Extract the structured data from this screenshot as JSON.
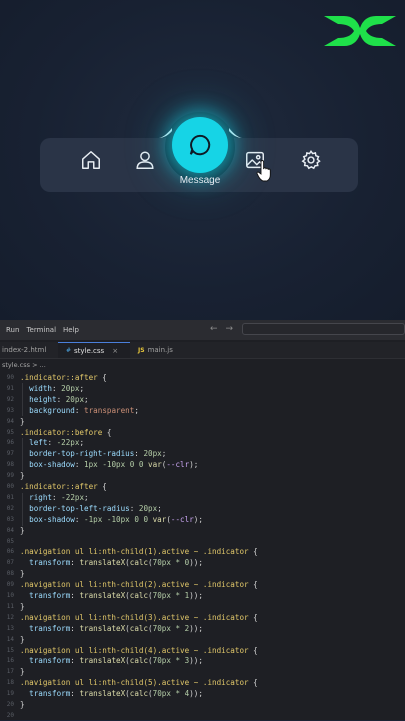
{
  "preview": {
    "nav_items": [
      {
        "icon": "home-icon"
      },
      {
        "icon": "user-icon"
      },
      {
        "icon": "message-icon",
        "label": "Message",
        "active": true
      },
      {
        "icon": "image-icon"
      },
      {
        "icon": "gear-icon"
      }
    ],
    "active_label": "Message",
    "accent": "#16d4e6"
  },
  "menu": [
    "Run",
    "Terminal",
    "Help"
  ],
  "tabs": [
    {
      "label": "index-2.html",
      "icon": "html-icon",
      "active": false
    },
    {
      "label": "style.css",
      "icon": "#",
      "active": true,
      "close": "×"
    },
    {
      "label": "main.js",
      "icon": "JS",
      "active": false
    }
  ],
  "breadcrumb": "style.css > ...",
  "code": [
    {
      "n": "90",
      "t": [
        [
          "sel",
          ".indicator::after "
        ],
        [
          "pun",
          "{"
        ]
      ]
    },
    {
      "n": "91",
      "t": [
        [
          "prop",
          "  width"
        ],
        [
          "pun",
          ": "
        ],
        [
          "num",
          "20px"
        ],
        [
          "pun",
          ";"
        ]
      ]
    },
    {
      "n": "92",
      "t": [
        [
          "prop",
          "  height"
        ],
        [
          "pun",
          ": "
        ],
        [
          "num",
          "20px"
        ],
        [
          "pun",
          ";"
        ]
      ]
    },
    {
      "n": "93",
      "t": [
        [
          "prop",
          "  background"
        ],
        [
          "pun",
          ": "
        ],
        [
          "val",
          "transparent"
        ],
        [
          "pun",
          ";"
        ]
      ]
    },
    {
      "n": "94",
      "t": [
        [
          "pun",
          "}"
        ]
      ]
    },
    {
      "n": "95",
      "t": [
        [
          "sel",
          ".indicator::before "
        ],
        [
          "pun",
          "{"
        ]
      ]
    },
    {
      "n": "96",
      "t": [
        [
          "prop",
          "  left"
        ],
        [
          "pun",
          ": "
        ],
        [
          "num",
          "-22px"
        ],
        [
          "pun",
          ";"
        ]
      ]
    },
    {
      "n": "97",
      "t": [
        [
          "prop",
          "  border-top-right-radius"
        ],
        [
          "pun",
          ": "
        ],
        [
          "num",
          "20px"
        ],
        [
          "pun",
          ";"
        ]
      ]
    },
    {
      "n": "98",
      "t": [
        [
          "prop",
          "  box-shadow"
        ],
        [
          "pun",
          ": "
        ],
        [
          "num",
          "1px -10px 0 0 "
        ],
        [
          "fn",
          "var"
        ],
        [
          "pun",
          "("
        ],
        [
          "var",
          "--clr"
        ],
        [
          "pun",
          ");"
        ]
      ]
    },
    {
      "n": "99",
      "t": [
        [
          "pun",
          "}"
        ]
      ]
    },
    {
      "n": "00",
      "t": [
        [
          "sel",
          ".indicator::after "
        ],
        [
          "pun",
          "{"
        ]
      ]
    },
    {
      "n": "01",
      "t": [
        [
          "prop",
          "  right"
        ],
        [
          "pun",
          ": "
        ],
        [
          "num",
          "-22px"
        ],
        [
          "pun",
          ";"
        ]
      ]
    },
    {
      "n": "02",
      "t": [
        [
          "prop",
          "  border-top-left-radius"
        ],
        [
          "pun",
          ": "
        ],
        [
          "num",
          "20px"
        ],
        [
          "pun",
          ";"
        ]
      ]
    },
    {
      "n": "03",
      "t": [
        [
          "prop",
          "  box-shadow"
        ],
        [
          "pun",
          ": "
        ],
        [
          "num",
          "-1px -10px 0 0 "
        ],
        [
          "fn",
          "var"
        ],
        [
          "pun",
          "("
        ],
        [
          "var",
          "--clr"
        ],
        [
          "pun",
          ");"
        ]
      ]
    },
    {
      "n": "04",
      "t": [
        [
          "pun",
          "}"
        ]
      ]
    },
    {
      "n": "05",
      "t": []
    },
    {
      "n": "06",
      "t": [
        [
          "sel",
          ".navigation ul li:nth-child(1).active ~ .indicator "
        ],
        [
          "pun",
          "{"
        ]
      ]
    },
    {
      "n": "07",
      "t": [
        [
          "prop",
          "  transform"
        ],
        [
          "pun",
          ": "
        ],
        [
          "fn",
          "translateX"
        ],
        [
          "pun",
          "("
        ],
        [
          "fn",
          "calc"
        ],
        [
          "pun",
          "("
        ],
        [
          "num",
          "70px * 0"
        ],
        [
          "pun",
          "));"
        ]
      ]
    },
    {
      "n": "08",
      "t": [
        [
          "pun",
          "}"
        ]
      ]
    },
    {
      "n": "09",
      "t": [
        [
          "sel",
          ".navigation ul li:nth-child(2).active ~ .indicator "
        ],
        [
          "pun",
          "{"
        ]
      ]
    },
    {
      "n": "10",
      "t": [
        [
          "prop",
          "  transform"
        ],
        [
          "pun",
          ": "
        ],
        [
          "fn",
          "translateX"
        ],
        [
          "pun",
          "("
        ],
        [
          "fn",
          "calc"
        ],
        [
          "pun",
          "("
        ],
        [
          "num",
          "70px * 1"
        ],
        [
          "pun",
          "));"
        ]
      ]
    },
    {
      "n": "11",
      "t": [
        [
          "pun",
          "}"
        ]
      ]
    },
    {
      "n": "12",
      "t": [
        [
          "sel",
          ".navigation ul li:nth-child(3).active ~ .indicator "
        ],
        [
          "pun",
          "{"
        ]
      ]
    },
    {
      "n": "13",
      "t": [
        [
          "prop",
          "  transform"
        ],
        [
          "pun",
          ": "
        ],
        [
          "fn",
          "translateX"
        ],
        [
          "pun",
          "("
        ],
        [
          "fn",
          "calc"
        ],
        [
          "pun",
          "("
        ],
        [
          "num",
          "70px * 2"
        ],
        [
          "pun",
          "));"
        ]
      ]
    },
    {
      "n": "14",
      "t": [
        [
          "pun",
          "}"
        ]
      ]
    },
    {
      "n": "15",
      "t": [
        [
          "sel",
          ".navigation ul li:nth-child(4).active ~ .indicator "
        ],
        [
          "pun",
          "{"
        ]
      ]
    },
    {
      "n": "16",
      "t": [
        [
          "prop",
          "  transform"
        ],
        [
          "pun",
          ": "
        ],
        [
          "fn",
          "translateX"
        ],
        [
          "pun",
          "("
        ],
        [
          "fn",
          "calc"
        ],
        [
          "pun",
          "("
        ],
        [
          "num",
          "70px * 3"
        ],
        [
          "pun",
          "));"
        ]
      ]
    },
    {
      "n": "17",
      "t": [
        [
          "pun",
          "}"
        ]
      ]
    },
    {
      "n": "18",
      "t": [
        [
          "sel",
          ".navigation ul li:nth-child(5).active ~ .indicator "
        ],
        [
          "pun",
          "{"
        ]
      ]
    },
    {
      "n": "19",
      "t": [
        [
          "prop",
          "  transform"
        ],
        [
          "pun",
          ": "
        ],
        [
          "fn",
          "translateX"
        ],
        [
          "pun",
          "("
        ],
        [
          "fn",
          "calc"
        ],
        [
          "pun",
          "("
        ],
        [
          "num",
          "70px * 4"
        ],
        [
          "pun",
          "));"
        ]
      ]
    },
    {
      "n": "20",
      "t": [
        [
          "pun",
          "}"
        ]
      ]
    },
    {
      "n": "20",
      "t": []
    }
  ]
}
